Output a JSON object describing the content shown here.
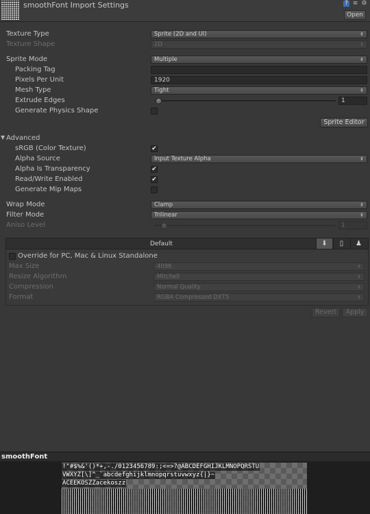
{
  "header": {
    "title": "smoothFont Import Settings",
    "open_label": "Open",
    "icons": [
      "book-icon",
      "settings-preset-icon",
      "gear-icon"
    ]
  },
  "texture_type": {
    "label": "Texture Type",
    "value": "Sprite (2D and UI)"
  },
  "texture_shape": {
    "label": "Texture Shape",
    "value": "2D"
  },
  "sprite_mode": {
    "label": "Sprite Mode",
    "value": "Multiple"
  },
  "packing_tag": {
    "label": "Packing Tag",
    "value": ""
  },
  "pixels_per_unit": {
    "label": "Pixels Per Unit",
    "value": "1920"
  },
  "mesh_type": {
    "label": "Mesh Type",
    "value": "Tight"
  },
  "extrude_edges": {
    "label": "Extrude Edges",
    "value": "1",
    "fraction": 0.02
  },
  "generate_physics_shape": {
    "label": "Generate Physics Shape",
    "checked": false
  },
  "sprite_editor_label": "Sprite Editor",
  "advanced": {
    "label": "Advanced",
    "srgb": {
      "label": "sRGB (Color Texture)",
      "checked": true
    },
    "alpha_source": {
      "label": "Alpha Source",
      "value": "Input Texture Alpha"
    },
    "alpha_is_transparency": {
      "label": "Alpha Is Transparency",
      "checked": true
    },
    "read_write": {
      "label": "Read/Write Enabled",
      "checked": true
    },
    "generate_mip_maps": {
      "label": "Generate Mip Maps",
      "checked": false
    }
  },
  "wrap_mode": {
    "label": "Wrap Mode",
    "value": "Clamp"
  },
  "filter_mode": {
    "label": "Filter Mode",
    "value": "Trilinear"
  },
  "aniso_level": {
    "label": "Aniso Level",
    "value": "1",
    "fraction": 0.05
  },
  "platform": {
    "default_label": "Default",
    "tabs": [
      "download-icon",
      "mobile-icon",
      "android-icon"
    ],
    "override_label": "Override for PC, Mac & Linux Standalone",
    "override_checked": false,
    "max_size": {
      "label": "Max Size",
      "value": "4096"
    },
    "resize_algorithm": {
      "label": "Resize Algorithm",
      "value": "Mitchell"
    },
    "compression": {
      "label": "Compression",
      "value": "Normal Quality"
    },
    "format": {
      "label": "Format",
      "value": "RGBA Compressed DXT5"
    }
  },
  "revert_label": "Revert",
  "apply_label": "Apply",
  "preview": {
    "title": "smoothFont",
    "line1": "!\"#$%&'()*+,-./0123456789:;<=>?@ABCDEFGHIJKLMNOPQRSTU",
    "line2": "VWXYZ[\\]^_`abcdefghijklmnopqrstuvwxyz{|}~",
    "line3": "ACEEKOSZZacekoszz"
  }
}
